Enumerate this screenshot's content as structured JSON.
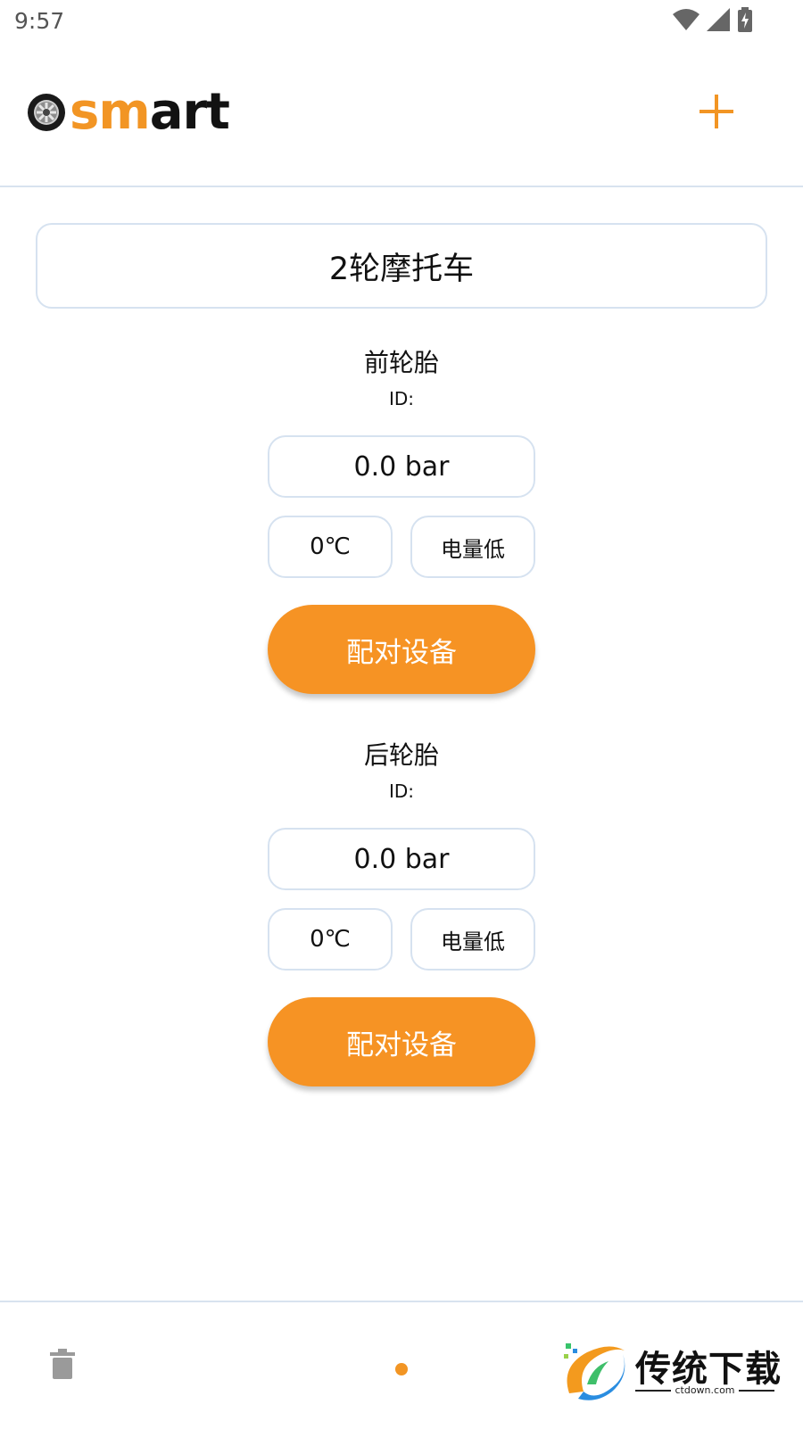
{
  "status_bar": {
    "time": "9:57"
  },
  "header": {
    "logo_text_accent": "sm",
    "logo_text_rest": "art",
    "accent_color": "#f29524"
  },
  "vehicle": {
    "name": "2轮摩托车"
  },
  "tires": [
    {
      "title": "前轮胎",
      "id_label": "ID:",
      "pressure": "0.0 bar",
      "temperature": "0℃",
      "battery": "电量低",
      "pair_label": "配对设备"
    },
    {
      "title": "后轮胎",
      "id_label": "ID:",
      "pressure": "0.0 bar",
      "temperature": "0℃",
      "battery": "电量低",
      "pair_label": "配对设备"
    }
  ],
  "bottom_bar": {
    "icons": [
      "trash-icon",
      "page-dot"
    ]
  },
  "watermark": {
    "title": "传统下载",
    "url": "ctdown.com"
  },
  "colors": {
    "accent": "#f69324",
    "border": "#d6e2f0"
  }
}
